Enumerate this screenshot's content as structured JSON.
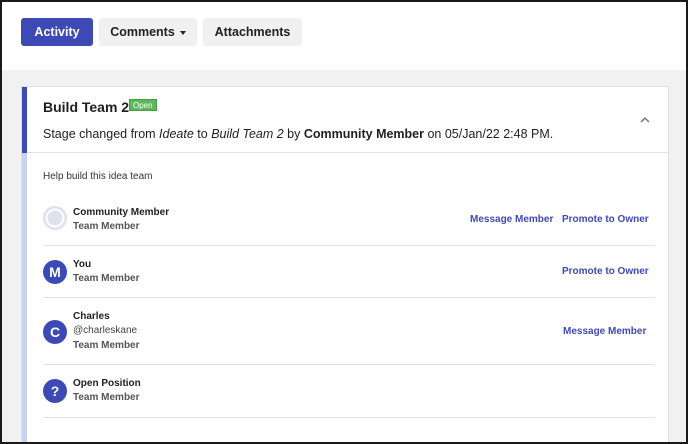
{
  "tabs": [
    {
      "label": "Activity",
      "active": true
    },
    {
      "label": "Comments",
      "has_dropdown": true
    },
    {
      "label": "Attachments"
    }
  ],
  "card": {
    "title": "Build Team 2",
    "badge": "Open",
    "stage": {
      "prefix": "Stage changed from ",
      "from": "Ideate",
      "middle": " to ",
      "to": "Build Team 2",
      "by": " by ",
      "author": "Community Member",
      "on": " on 05/Jan/22 2:48 PM."
    },
    "help_text": "Help build this idea team"
  },
  "members": [
    {
      "name": "Community Member",
      "role": "Team Member",
      "avatar": "default-user-icon",
      "actions": [
        "Message Member",
        "Promote to Owner"
      ]
    },
    {
      "name": "You",
      "role": "Team Member",
      "avatar_letter": "M",
      "actions": [
        "Promote to Owner"
      ]
    },
    {
      "name": "Charles",
      "handle": "@charleskane",
      "role": "Team Member",
      "avatar_letter": "C",
      "actions": [
        "Message Member"
      ]
    },
    {
      "name": "Open Position",
      "role": "Team Member",
      "avatar_letter": "?",
      "actions": []
    }
  ],
  "colors": {
    "accent": "#3d4ab6",
    "badge": "#5cb85c",
    "accent_light": "#c5d3ee"
  }
}
